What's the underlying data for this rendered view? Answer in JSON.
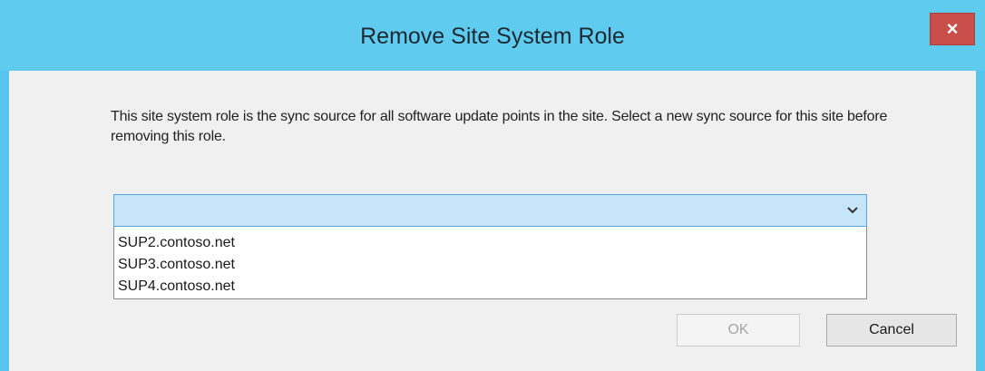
{
  "window": {
    "title": "Remove Site System Role",
    "close_glyph": "×"
  },
  "message": "This site system role is the sync source  for all software update points in the site. Select a new sync source for this site before removing this role.",
  "sync_source_select": {
    "selected_value": "",
    "options": [
      "SUP2.contoso.net",
      "SUP3.contoso.net",
      "SUP4.contoso.net"
    ],
    "chevron_icon": "chevron-down-icon"
  },
  "buttons": {
    "ok_label": "OK",
    "cancel_label": "Cancel"
  },
  "colors": {
    "title_bar": "#5ecbef",
    "close_button": "#c9504a",
    "combo_highlight": "#c6e6f8",
    "combo_border": "#5aa3d8"
  }
}
